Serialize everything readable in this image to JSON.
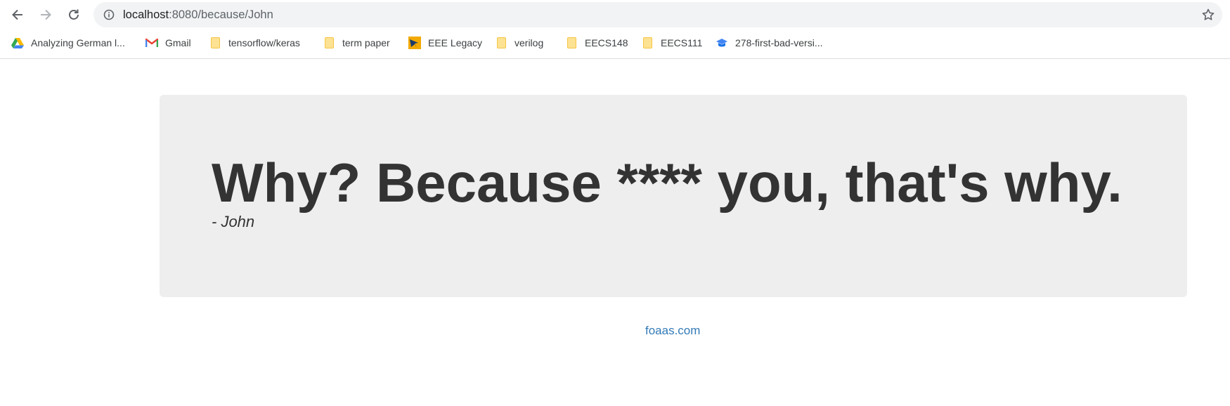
{
  "browser": {
    "url_host": "localhost",
    "url_path": ":8080/because/John",
    "bookmarks": [
      {
        "label": "Analyzing German l...",
        "icon": "google-drive-icon"
      },
      {
        "label": "Gmail",
        "icon": "gmail-icon"
      },
      {
        "label": "tensorflow/keras",
        "icon": "folder-icon"
      },
      {
        "label": "term paper",
        "icon": "folder-icon"
      },
      {
        "label": "EEE Legacy",
        "icon": "eee-logo-icon"
      },
      {
        "label": "verilog",
        "icon": "folder-icon"
      },
      {
        "label": "EECS148",
        "icon": "folder-icon"
      },
      {
        "label": "EECS111",
        "icon": "folder-icon"
      },
      {
        "label": "278-first-bad-versi...",
        "icon": "leetcode-icon"
      }
    ]
  },
  "content": {
    "message": "Why? Because **** you, that's why.",
    "subtitle": "- John",
    "footer_link": "foaas.com"
  },
  "colors": {
    "jumbotron_bg": "#eeeeee",
    "text": "#333333",
    "link": "#337ab7",
    "omnibox_bg": "#f1f3f4"
  }
}
